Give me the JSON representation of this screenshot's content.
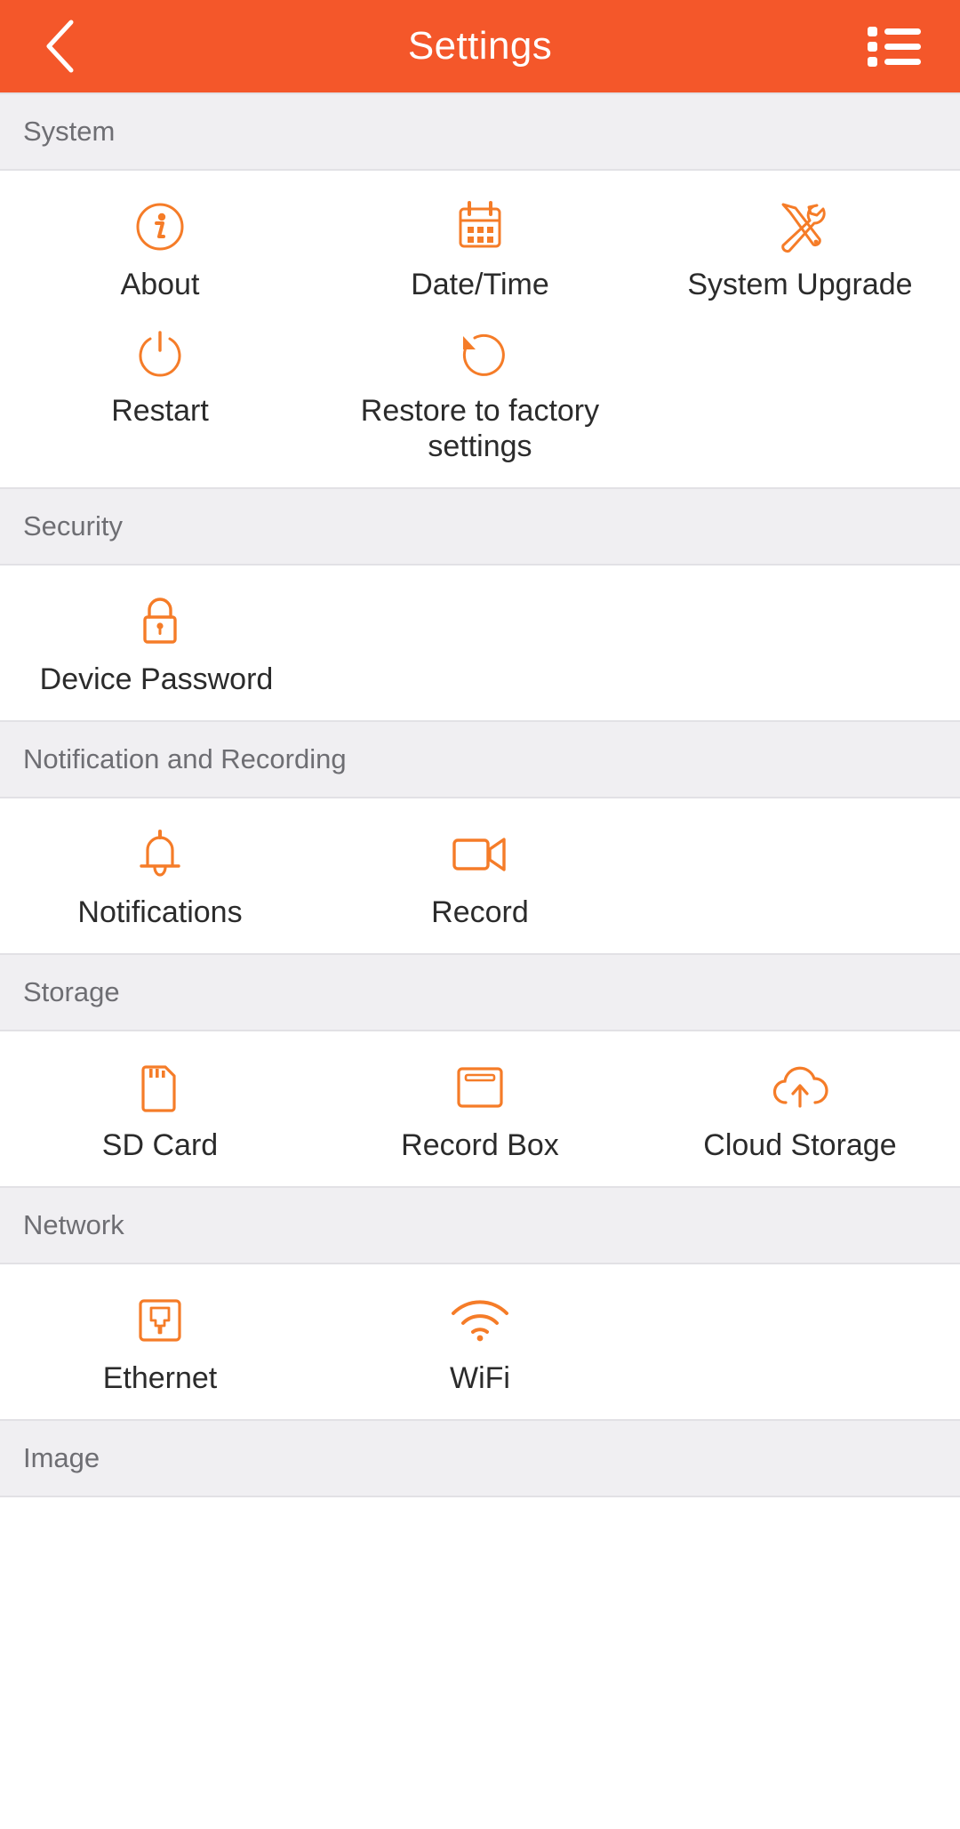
{
  "header": {
    "title": "Settings",
    "back_icon": "chevron-left-icon",
    "menu_icon": "list-menu-icon"
  },
  "theme": {
    "accent": "#F4572A",
    "icon_orange": "#F57C28",
    "section_bg": "#F0EFF2",
    "section_text": "#6E6E73",
    "label_text": "#2B2B2B",
    "panel_bg": "#FFFFFF",
    "divider": "#E2E1E5"
  },
  "sections": [
    {
      "title": "System",
      "items": [
        {
          "label": "About",
          "icon": "info-circle-icon"
        },
        {
          "label": "Date/Time",
          "icon": "calendar-icon"
        },
        {
          "label": "System Upgrade",
          "icon": "tools-icon"
        },
        {
          "label": "Restart",
          "icon": "power-icon"
        },
        {
          "label": "Restore to factory settings",
          "icon": "restore-icon"
        }
      ]
    },
    {
      "title": "Security",
      "items": [
        {
          "label": "Device Password",
          "icon": "lock-icon"
        }
      ]
    },
    {
      "title": "Notification and Recording",
      "items": [
        {
          "label": "Notifications",
          "icon": "bell-icon"
        },
        {
          "label": "Record",
          "icon": "video-camera-icon"
        }
      ]
    },
    {
      "title": "Storage",
      "items": [
        {
          "label": "SD Card",
          "icon": "sd-card-icon"
        },
        {
          "label": "Record Box",
          "icon": "record-box-icon"
        },
        {
          "label": "Cloud Storage",
          "icon": "cloud-upload-icon"
        }
      ]
    },
    {
      "title": "Network",
      "items": [
        {
          "label": "Ethernet",
          "icon": "ethernet-icon"
        },
        {
          "label": "WiFi",
          "icon": "wifi-icon"
        }
      ]
    },
    {
      "title": "Image",
      "items": []
    }
  ]
}
